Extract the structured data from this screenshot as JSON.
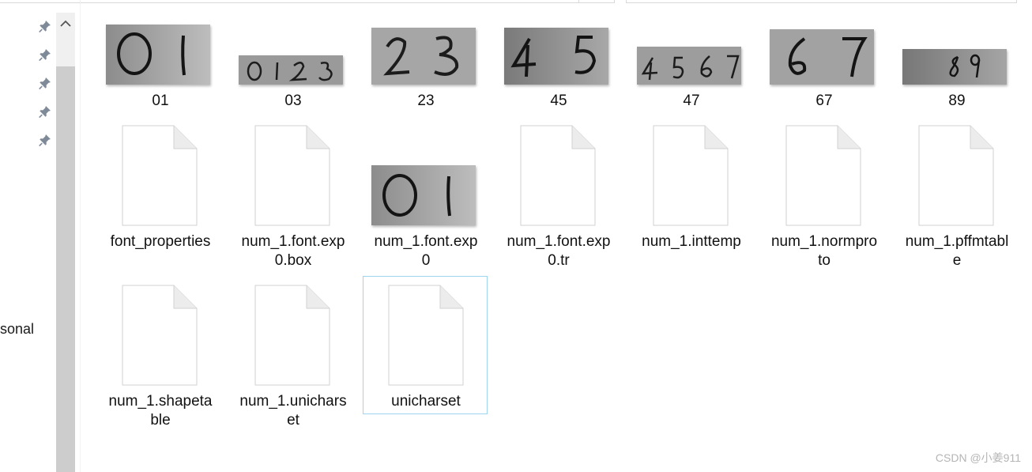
{
  "sidebar": {
    "pins": [
      "pin-icon",
      "pin-icon",
      "pin-icon",
      "pin-icon",
      "pin-icon"
    ],
    "truncated_label": "sonal"
  },
  "files": [
    {
      "name": "01",
      "kind": "image",
      "digits": "0 1"
    },
    {
      "name": "03",
      "kind": "image",
      "digits": "0 1 2 3"
    },
    {
      "name": "23",
      "kind": "image",
      "digits": "2 3"
    },
    {
      "name": "45",
      "kind": "image",
      "digits": "4 5"
    },
    {
      "name": "47",
      "kind": "image",
      "digits": "4 5 6 7"
    },
    {
      "name": "67",
      "kind": "image",
      "digits": "6 7"
    },
    {
      "name": "89",
      "kind": "image",
      "digits": "8 9"
    },
    {
      "name": "font_properties",
      "label_lines": [
        "font_properties"
      ],
      "kind": "file"
    },
    {
      "name": "num_1.font.exp0.box",
      "label_lines": [
        "num_1.font.exp",
        "0.box"
      ],
      "kind": "file"
    },
    {
      "name": "num_1.font.exp0",
      "label_lines": [
        "num_1.font.exp",
        "0"
      ],
      "kind": "image",
      "digits": "0 1"
    },
    {
      "name": "num_1.font.exp0.tr",
      "label_lines": [
        "num_1.font.exp",
        "0.tr"
      ],
      "kind": "file"
    },
    {
      "name": "num_1.inttemp",
      "label_lines": [
        "num_1.inttemp"
      ],
      "kind": "file"
    },
    {
      "name": "num_1.normproto",
      "label_lines": [
        "num_1.normpro",
        "to"
      ],
      "kind": "file"
    },
    {
      "name": "num_1.pffmtable",
      "label_lines": [
        "num_1.pffmtabl",
        "e"
      ],
      "kind": "file"
    },
    {
      "name": "num_1.shapetable",
      "label_lines": [
        "num_1.shapeta",
        "ble"
      ],
      "kind": "file"
    },
    {
      "name": "num_1.unicharset",
      "label_lines": [
        "num_1.unichars",
        "et"
      ],
      "kind": "file"
    },
    {
      "name": "unicharset",
      "label_lines": [
        "unicharset"
      ],
      "kind": "file",
      "selected": true
    }
  ],
  "watermark": "CSDN @小姜911"
}
